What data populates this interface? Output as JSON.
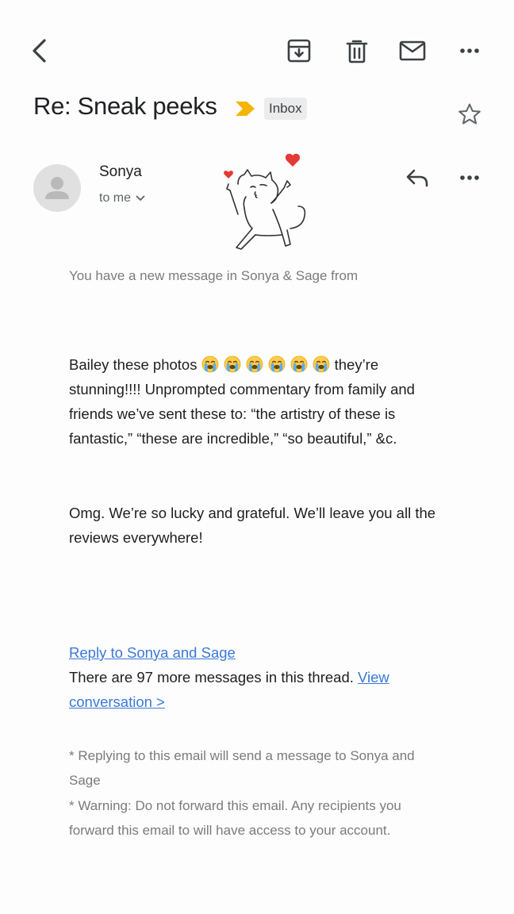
{
  "toolbar": {
    "back_icon": "chevron-left-icon",
    "archive_icon": "archive-icon",
    "delete_icon": "trash-icon",
    "mark_unread_icon": "envelope-icon",
    "more_icon": "more-horizontal-icon"
  },
  "header": {
    "subject": "Re: Sneak peeks",
    "importance_icon": "importance-marker-icon",
    "label": "Inbox",
    "star_icon": "star-outline-icon"
  },
  "message": {
    "sender": "Sonya",
    "recipient": "to me",
    "recipient_icon": "chevron-down-icon",
    "reply_icon": "reply-icon",
    "more_icon": "more-horizontal-icon",
    "sticker": "cat-hearts-sticker",
    "preview": "You have a new message in Sonya & Sage from",
    "paragraph1_start": "Bailey these photos",
    "emoji_count": 6,
    "emoji": "loudly-crying-face-emoji",
    "paragraph1_end": "they’re stunning!!!! Unprompted commentary from family and friends we’ve sent these to: “the artistry of these is fantastic,” “these are incredible,” “so beautiful,” &c.",
    "paragraph2": "Omg. We’re so lucky and grateful. We’ll leave you all the reviews everywhere!",
    "reply_link": "Reply to Sonya and Sage",
    "thread_text": "There are 97 more messages in this thread.",
    "thread_link_1": "View",
    "thread_link_2": "conversation >",
    "footnote1": "* Replying to this email will send a message to Sonya and Sage",
    "footnote2": "* Warning: Do not forward this email. Any recipients you forward this email to will have access to your account."
  },
  "colors": {
    "accent_link": "#3b78d8",
    "importance": "#f4b400",
    "heart": "#e53935"
  }
}
